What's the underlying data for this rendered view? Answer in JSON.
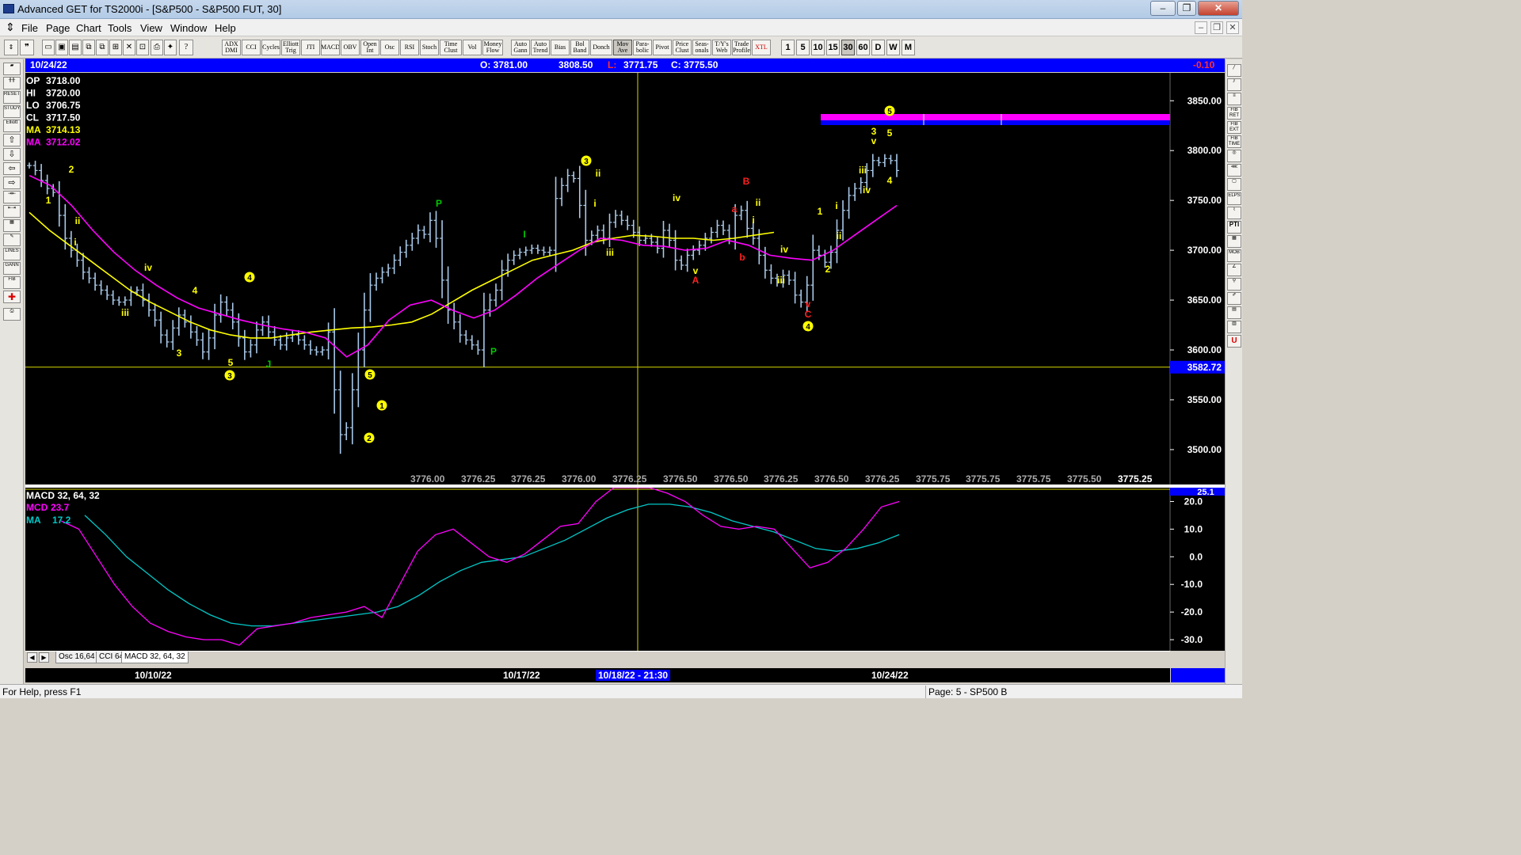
{
  "window": {
    "title": "Advanced GET for TS2000i - [S&P500 - S&P500 FUT, 30]",
    "minimize": "–",
    "restore": "❐",
    "close": "✕"
  },
  "menu": [
    "File",
    "Page",
    "Chart",
    "Tools",
    "View",
    "Window",
    "Help"
  ],
  "toolbar": {
    "study_buttons": [
      "ADX DMI",
      "CCI",
      "Cycles",
      "Elliott Trig",
      "JTI",
      "MACD",
      "OBV",
      "Open Int",
      "Osc",
      "RSI",
      "Stoch",
      "Time Clust",
      "Vol",
      "Money Flow",
      "Auto Gann",
      "Auto Trend",
      "Bias",
      "Bol Band",
      "Donch",
      "Mov Ave",
      "Para-bolic",
      "Pivot",
      "Price Clust",
      "Seas-onals",
      "T/Y's Web",
      "Trade Profile",
      "XTL"
    ],
    "timeframes": [
      "1",
      "5",
      "10",
      "15",
      "30",
      "60",
      "D",
      "W",
      "M"
    ],
    "active_timeframe": "30"
  },
  "chart_header": {
    "date": "10/24/22",
    "open": "O: 3781.00",
    "high": "3808.50",
    "low_label": "L:",
    "low": "3771.75",
    "close": "C: 3775.50",
    "change": "-0.10"
  },
  "legend": [
    {
      "label": "OP",
      "value": "3718.00",
      "color": "#ffffff"
    },
    {
      "label": "HI",
      "value": "3720.00",
      "color": "#ffffff"
    },
    {
      "label": "LO",
      "value": "3706.75",
      "color": "#ffffff"
    },
    {
      "label": "CL",
      "value": "3717.50",
      "color": "#ffffff"
    },
    {
      "label": "MA",
      "value": "3714.13",
      "color": "#ffff00"
    },
    {
      "label": "MA",
      "value": "3712.02",
      "color": "#ff00ff"
    }
  ],
  "price_axis": {
    "ticks": [
      "3850.00",
      "3800.00",
      "3750.00",
      "3700.00",
      "3650.00",
      "3600.00",
      "3550.00",
      "3500.00"
    ],
    "cursor_price": "3582.72"
  },
  "bottom_values": [
    "3776.00",
    "3776.25",
    "3776.25",
    "3776.00",
    "3776.25",
    "3776.50",
    "3776.50",
    "3776.25",
    "3776.50",
    "3776.25",
    "3775.75",
    "3775.75",
    "3775.75",
    "3775.50",
    "3775.25"
  ],
  "osc_legend": {
    "title": "MACD 32, 64, 32",
    "mcd_label": "MCD",
    "mcd_value": "23.7",
    "ma_label": "MA",
    "ma_value": "17.2"
  },
  "osc_axis": {
    "ticks": [
      "20.0",
      "10.0",
      "0.0",
      "-10.0",
      "-20.0",
      "-30.0"
    ],
    "top_value": "25.1"
  },
  "osc_tabs": [
    "Osc 16,64",
    "CCI 64",
    "MACD 32, 64, 32"
  ],
  "date_axis": {
    "labels": [
      "10/10/22",
      "10/17/22",
      "10/24/22"
    ],
    "cursor_date": "10/18/22 - 21:30"
  },
  "wave_labels": [
    "1",
    "2",
    "ii",
    "i",
    "iii",
    "iv",
    "4",
    "3",
    "5",
    "3",
    "4",
    "J",
    "5",
    "1",
    "2",
    "P",
    "P",
    "I",
    "3",
    "ii",
    "i",
    "iii",
    "iv",
    "v",
    "A",
    "a",
    "B",
    "b",
    "ii",
    "i",
    "iv",
    "iii",
    "v",
    "C",
    "4",
    "1",
    "2",
    "i",
    "ii",
    "iii",
    "iv",
    "3",
    "v",
    "5",
    "4",
    "5"
  ],
  "colors": {
    "chart_bg": "#000000",
    "bars": "#a8c8e8",
    "ma_fast": "#ffff00",
    "ma_slow": "#ff00ff",
    "macd_line": "#ff00ff",
    "macd_signal": "#00c8c8",
    "target_band": "#ff00ff",
    "header_blue": "#0000ff"
  },
  "chart_data": {
    "type": "ohlc",
    "price_ticks": [
      3850,
      3800,
      3750,
      3700,
      3650,
      3600,
      3550,
      3500
    ],
    "ylim": [
      3465,
      3878
    ],
    "cursor_price": 3582.72,
    "closes": [
      3785,
      3780,
      3770,
      3762,
      3758,
      3735,
      3712,
      3700,
      3690,
      3678,
      3672,
      3665,
      3660,
      3655,
      3650,
      3648,
      3650,
      3658,
      3660,
      3650,
      3640,
      3630,
      3615,
      3608,
      3622,
      3635,
      3628,
      3618,
      3610,
      3598,
      3612,
      3635,
      3648,
      3640,
      3628,
      3612,
      3598,
      3605,
      3620,
      3628,
      3618,
      3610,
      3605,
      3612,
      3615,
      3610,
      3605,
      3600,
      3598,
      3600,
      3618,
      3560,
      3515,
      3522,
      3560,
      3600,
      3640,
      3665,
      3672,
      3678,
      3682,
      3690,
      3698,
      3705,
      3712,
      3720,
      3716,
      3730,
      3712,
      3670,
      3640,
      3628,
      3615,
      3610,
      3605,
      3600,
      3640,
      3650,
      3660,
      3680,
      3690,
      3695,
      3698,
      3700,
      3702,
      3700,
      3698,
      3700,
      3752,
      3765,
      3775,
      3772,
      3745,
      3710,
      3715,
      3720,
      3712,
      3728,
      3735,
      3730,
      3725,
      3718,
      3710,
      3712,
      3708,
      3702,
      3720,
      3710,
      3690,
      3685,
      3695,
      3700,
      3705,
      3712,
      3718,
      3725,
      3720,
      3712,
      3735,
      3740,
      3722,
      3712,
      3695,
      3680,
      3672,
      3668,
      3675,
      3670,
      3655,
      3648,
      3665,
      3700,
      3695,
      3688,
      3698,
      3720,
      3740,
      3755,
      3762,
      3768,
      3780,
      3790,
      3788,
      3792,
      3790,
      3780
    ],
    "ma_fast": [
      3738,
      3720,
      3705,
      3690,
      3675,
      3660,
      3648,
      3638,
      3628,
      3620,
      3615,
      3612,
      3612,
      3615,
      3618,
      3620,
      3622,
      3623,
      3625,
      3628,
      3636,
      3648,
      3660,
      3670,
      3680,
      3690,
      3695,
      3700,
      3708,
      3712,
      3715,
      3714,
      3712,
      3712,
      3710,
      3712,
      3715,
      3718
    ],
    "ma_slow": [
      3775,
      3765,
      3745,
      3720,
      3698,
      3680,
      3665,
      3652,
      3642,
      3636,
      3630,
      3625,
      3621,
      3618,
      3612,
      3593,
      3605,
      3630,
      3645,
      3650,
      3640,
      3632,
      3640,
      3655,
      3672,
      3686,
      3700,
      3712,
      3710,
      3705,
      3704,
      3700,
      3702,
      3710,
      3705,
      3695,
      3692,
      3690,
      3700,
      3715,
      3730,
      3745
    ],
    "macd": [
      13,
      10,
      0,
      -10,
      -18,
      -24,
      -27,
      -29,
      -30,
      -30,
      -32,
      -26,
      -25,
      -24,
      -22,
      -21,
      -20,
      -18,
      -22,
      -10,
      2,
      8,
      10,
      5,
      0,
      -2,
      1,
      6,
      11,
      12,
      20,
      25,
      25,
      25,
      23,
      20,
      15,
      11,
      10,
      11,
      10,
      3,
      -4,
      -2,
      3,
      10,
      18,
      20
    ],
    "macd_signal": [
      15,
      8,
      0,
      -6,
      -12,
      -17,
      -21,
      -24,
      -25,
      -25,
      -24,
      -23,
      -22,
      -21,
      -20,
      -18,
      -14,
      -9,
      -5,
      -2,
      -1,
      0,
      3,
      6,
      10,
      14,
      17,
      19,
      19,
      18,
      16,
      13,
      11,
      9,
      6,
      3,
      2,
      3,
      5,
      8
    ],
    "macd_ticks": [
      20,
      10,
      0,
      -10,
      -20,
      -30
    ],
    "macd_ylim": [
      -34,
      25
    ]
  }
}
